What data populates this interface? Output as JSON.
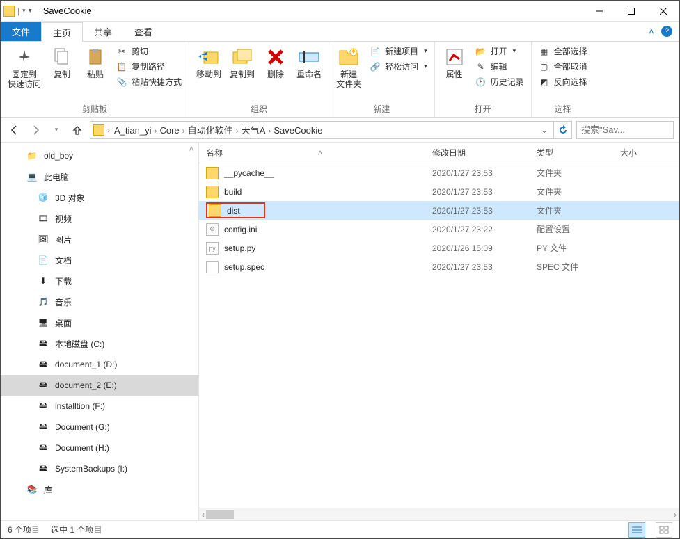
{
  "title": "SaveCookie",
  "tabs": {
    "file": "文件",
    "home": "主页",
    "share": "共享",
    "view": "查看"
  },
  "ribbon": {
    "clipboard": {
      "label": "剪贴板",
      "pin": "固定到\n快速访问",
      "copy": "复制",
      "paste": "粘贴",
      "cut": "剪切",
      "copypath": "复制路径",
      "pasteshortcut": "粘贴快捷方式"
    },
    "organize": {
      "label": "组织",
      "moveto": "移动到",
      "copyto": "复制到",
      "delete": "删除",
      "rename": "重命名"
    },
    "new": {
      "label": "新建",
      "newfolder": "新建\n文件夹",
      "newitem": "新建项目",
      "easyaccess": "轻松访问"
    },
    "open": {
      "label": "打开",
      "properties": "属性",
      "open": "打开",
      "edit": "编辑",
      "history": "历史记录"
    },
    "select": {
      "label": "选择",
      "selectall": "全部选择",
      "selectnone": "全部取消",
      "invert": "反向选择"
    }
  },
  "breadcrumb": [
    "A_tian_yi",
    "Core",
    "自动化软件",
    "天气A",
    "SaveCookie"
  ],
  "search_placeholder": "搜索\"Sav...",
  "columns": {
    "name": "名称",
    "date": "修改日期",
    "type": "类型",
    "size": "大小"
  },
  "nav": [
    {
      "label": "old_boy",
      "icon": "folder-user",
      "level": 1
    },
    {
      "label": "此电脑",
      "icon": "pc",
      "level": 1
    },
    {
      "label": "3D 对象",
      "icon": "3d",
      "level": 2
    },
    {
      "label": "视频",
      "icon": "video",
      "level": 2
    },
    {
      "label": "图片",
      "icon": "pictures",
      "level": 2
    },
    {
      "label": "文档",
      "icon": "documents",
      "level": 2
    },
    {
      "label": "下载",
      "icon": "downloads",
      "level": 2
    },
    {
      "label": "音乐",
      "icon": "music",
      "level": 2
    },
    {
      "label": "桌面",
      "icon": "desktop",
      "level": 2
    },
    {
      "label": "本地磁盘 (C:)",
      "icon": "drive",
      "level": 2
    },
    {
      "label": "document_1 (D:)",
      "icon": "drive",
      "level": 2
    },
    {
      "label": "document_2 (E:)",
      "icon": "drive",
      "level": 2,
      "selected": true
    },
    {
      "label": "installtion (F:)",
      "icon": "drive",
      "level": 2
    },
    {
      "label": "Document (G:)",
      "icon": "drive",
      "level": 2
    },
    {
      "label": "Document (H:)",
      "icon": "drive",
      "level": 2
    },
    {
      "label": "SystemBackups (I:)",
      "icon": "drive",
      "level": 2
    },
    {
      "label": "库",
      "icon": "lib",
      "level": 1
    }
  ],
  "files": [
    {
      "name": "__pycache__",
      "date": "2020/1/27 23:53",
      "type": "文件夹",
      "kind": "folder"
    },
    {
      "name": "build",
      "date": "2020/1/27 23:53",
      "type": "文件夹",
      "kind": "folder"
    },
    {
      "name": "dist",
      "date": "2020/1/27 23:53",
      "type": "文件夹",
      "kind": "folder",
      "selected": true,
      "highlighted": true
    },
    {
      "name": "config.ini",
      "date": "2020/1/27 23:22",
      "type": "配置设置",
      "kind": "ini"
    },
    {
      "name": "setup.py",
      "date": "2020/1/26 15:09",
      "type": "PY 文件",
      "kind": "py"
    },
    {
      "name": "setup.spec",
      "date": "2020/1/27 23:53",
      "type": "SPEC 文件",
      "kind": "spec"
    }
  ],
  "status": {
    "count": "6 个项目",
    "selected": "选中 1 个项目"
  }
}
